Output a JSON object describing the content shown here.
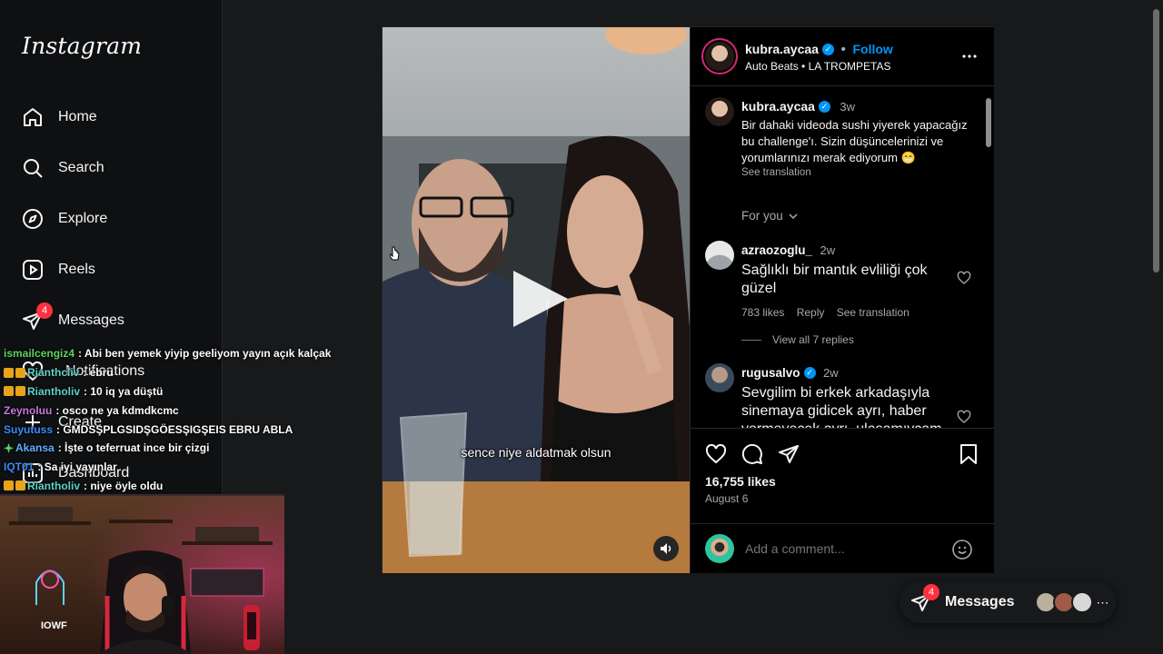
{
  "app": {
    "logo": "Instagram"
  },
  "sidebar": {
    "items": [
      {
        "label": "Home",
        "icon": "home-icon"
      },
      {
        "label": "Search",
        "icon": "search-icon"
      },
      {
        "label": "Explore",
        "icon": "compass-icon"
      },
      {
        "label": "Reels",
        "icon": "reels-icon"
      },
      {
        "label": "Messages",
        "icon": "messenger-icon",
        "badge": "4"
      },
      {
        "label": "Notifications",
        "icon": "heart-icon"
      },
      {
        "label": "Create",
        "icon": "plus-icon"
      },
      {
        "label": "Dashboard",
        "icon": "dashboard-icon"
      }
    ]
  },
  "chat": [
    {
      "user": "ismailcengiz4",
      "color": "#5fd35f",
      "badges": 0,
      "text": ": Abi ben yemek yiyip geeliyom yayın açık kalçak"
    },
    {
      "user": "Rianthcliv",
      "color": "#5fd3c8",
      "badges": 2,
      "text": ": ebru"
    },
    {
      "user": "Riantholiv",
      "color": "#5fd3c8",
      "badges": 2,
      "text": ": 10 iq ya düştü"
    },
    {
      "user": "Zeynoluu",
      "color": "#c77ad8",
      "badges": 0,
      "text": ": osco ne ya kdmdkcmc"
    },
    {
      "user": "Suyutuss",
      "color": "#3b8cff",
      "badges": 0,
      "text": ": GMDSŞPLGSIDŞGÖESŞIGŞEIS EBRU ABLA"
    },
    {
      "user": "Akansa",
      "color": "#5fb0ff",
      "badges": 1,
      "text": ": İşte o teferruat ince bir çizgi"
    },
    {
      "user": "IQT01",
      "color": "#3b8cff",
      "badges": 0,
      "text": ": Sa iyi yayınlar"
    },
    {
      "user": "Riantholiv",
      "color": "#5fd3c8",
      "badges": 2,
      "text": ": niye öyle oldu"
    }
  ],
  "webcam": {
    "brand": "IOWF"
  },
  "post": {
    "author": "kubra.aycaa",
    "follow": "Follow",
    "audio": "Auto Beats • LA TROMPETAS",
    "caption": {
      "user": "kubra.aycaa",
      "time": "3w",
      "text": "Bir dahaki videoda sushi yiyerek yapacağız bu challenge'ı. Sizin düşüncelerinizi ve yorumlarınızı merak ediyorum 😁",
      "translation": "See translation"
    },
    "sort": "For you",
    "comments": [
      {
        "user": "azraozoglu_",
        "time": "2w",
        "text": "Sağlıklı bir mantık evliliği çok güzel",
        "likes": "783 likes",
        "reply": "Reply",
        "translation": "See translation",
        "replies": "View all 7 replies"
      },
      {
        "user": "rugusalvo",
        "time": "2w",
        "verified": true,
        "text": "Sevgilim bi erkek arkadaşıyla sinemaya gidicek ayrı, haber vermeyecek ayrı, ulaşamıycam"
      }
    ],
    "subtitle": "sence niye aldatmak olsun",
    "likes": "16,755 likes",
    "date": "August 6",
    "add_comment_placeholder": "Add a comment..."
  },
  "floating": {
    "label": "Messages",
    "badge": "4"
  }
}
